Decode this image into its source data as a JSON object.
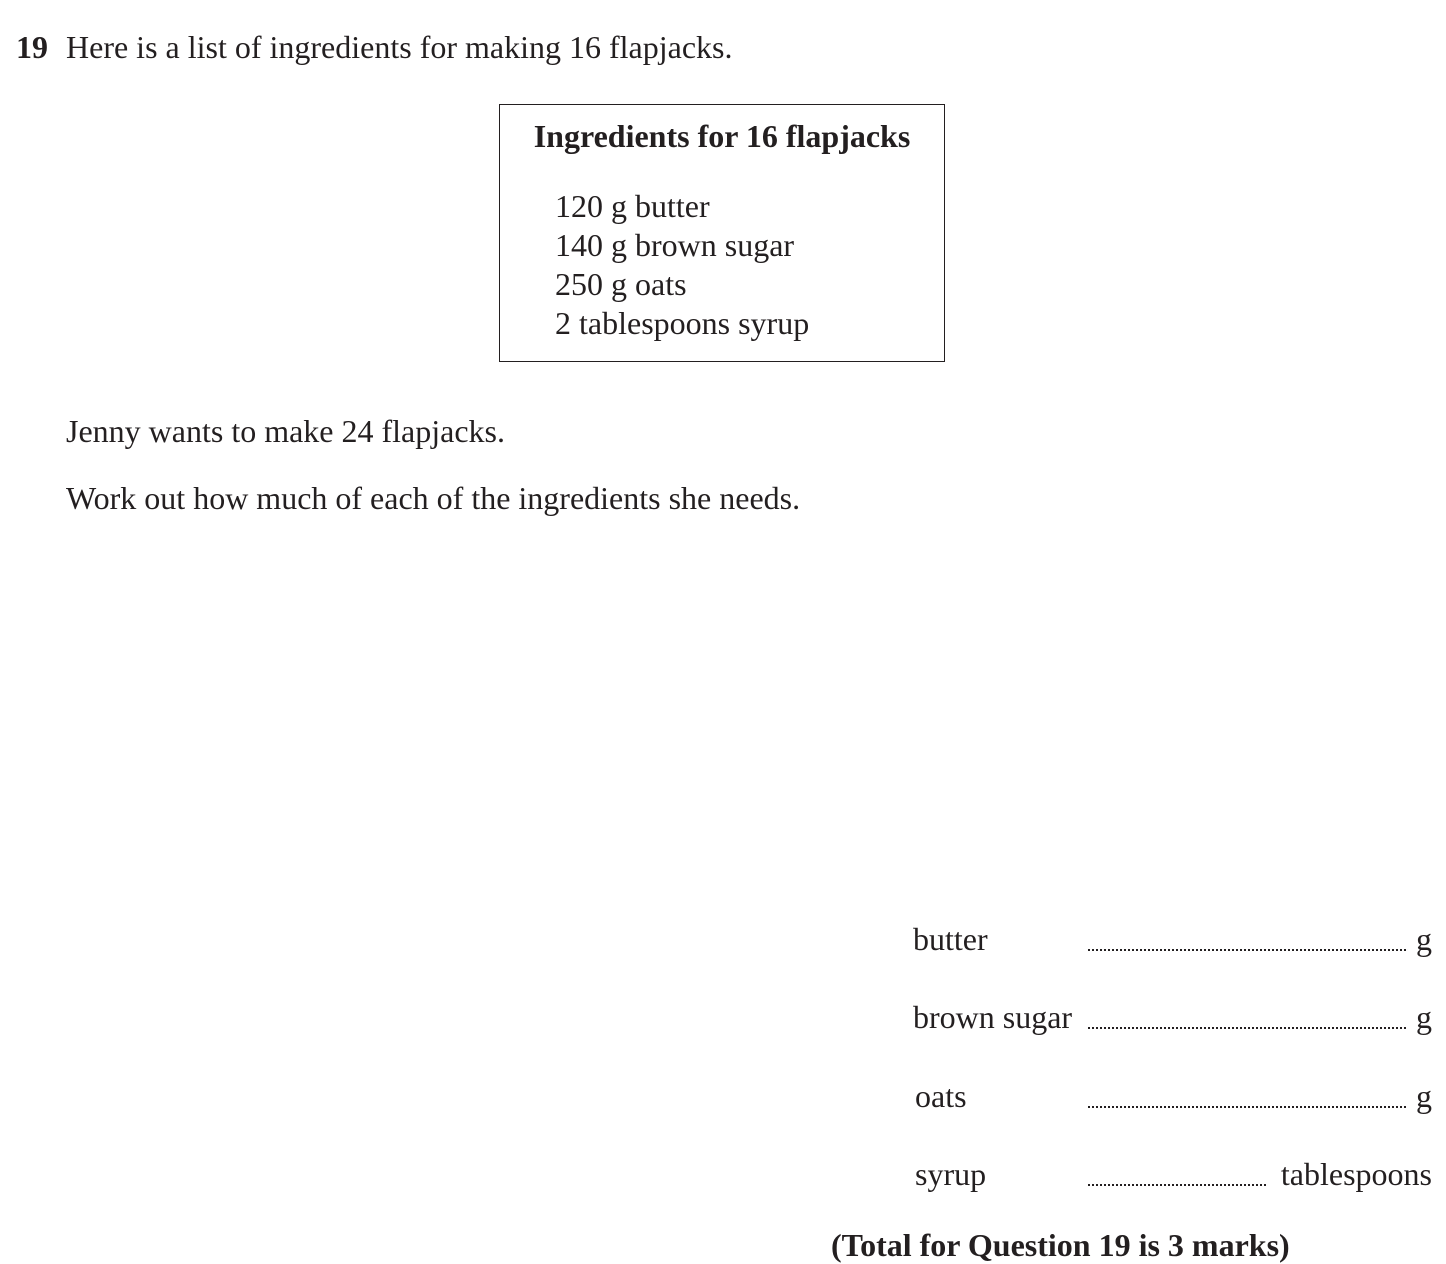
{
  "question": {
    "number": "19",
    "intro": "Here is a list of ingredients for making 16 flapjacks."
  },
  "ingredients_box": {
    "title": "Ingredients for 16 flapjacks",
    "items": [
      "120 g butter",
      "140 g brown sugar",
      "250 g oats",
      "2 tablespoons syrup"
    ]
  },
  "body": {
    "line1": "Jenny wants to make 24 flapjacks.",
    "line2": "Work out how much of each of the ingredients she needs."
  },
  "answers": [
    {
      "label": "butter",
      "value": "",
      "unit": "g"
    },
    {
      "label": "brown sugar",
      "value": "",
      "unit": "g"
    },
    {
      "label": "oats",
      "value": "",
      "unit": "g"
    },
    {
      "label": "syrup",
      "value": "",
      "unit": "tablespoons"
    }
  ],
  "total": "(Total for Question 19 is 3 marks)"
}
